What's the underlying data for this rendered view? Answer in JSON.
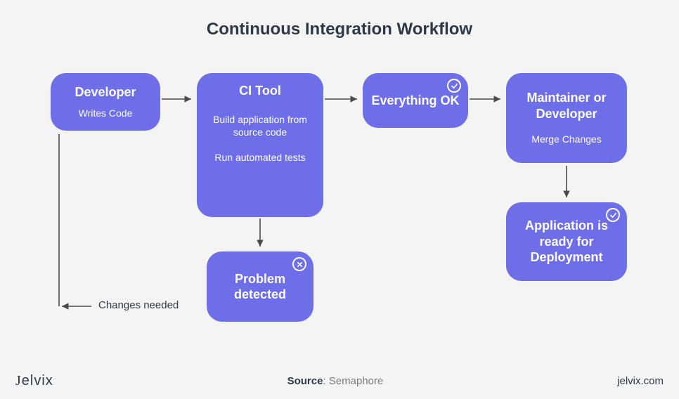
{
  "title": "Continuous Integration Workflow",
  "nodes": {
    "developer": {
      "title": "Developer",
      "sub": "Writes Code"
    },
    "ci_tool": {
      "title": "CI Tool",
      "line1": "Build application from source code",
      "line2": "Run automated tests"
    },
    "everything_ok": {
      "title": "Everything OK"
    },
    "maintainer": {
      "title": "Maintainer or Developer",
      "sub": "Merge Changes"
    },
    "deploy": {
      "title": "Application is ready for Deployment"
    },
    "problem": {
      "title": "Problem detected"
    }
  },
  "feedback_label": "Changes needed",
  "brand": "Jelvix",
  "source_label": "Source",
  "source_value": "Semaphore",
  "site": "jelvix.com",
  "colors": {
    "node": "#6e6ee8",
    "arrow": "#4a4a4a",
    "bg": "#f4f4f4"
  }
}
